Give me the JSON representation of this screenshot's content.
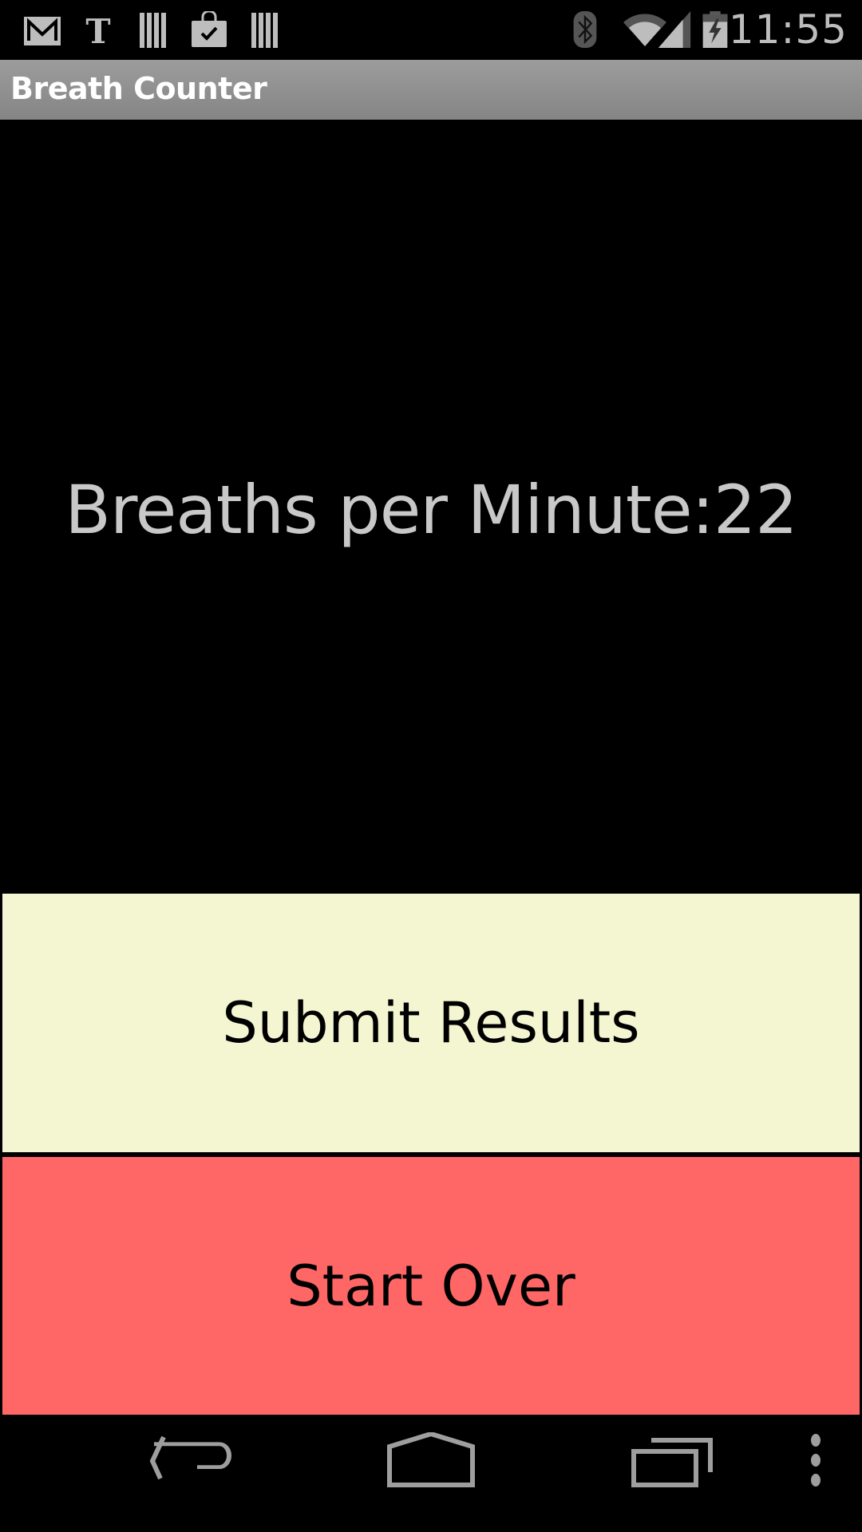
{
  "status_bar": {
    "notification_icons": [
      "gmail-icon",
      "nytimes-icon",
      "barcode-icon",
      "shopping-bag-check-icon",
      "barcode-icon"
    ],
    "system_icons": [
      "bluetooth-icon",
      "wifi-icon",
      "cell-signal-icon",
      "battery-charging-icon"
    ],
    "time": "11:55"
  },
  "action_bar": {
    "title": "Breath Counter"
  },
  "main": {
    "result_text": "Breaths per Minute:22"
  },
  "buttons": {
    "submit_label": "Submit Results",
    "start_over_label": "Start Over"
  },
  "colors": {
    "submit_bg": "#f3f6d0",
    "start_over_bg": "#ff6666",
    "result_text": "#c8c8c8"
  },
  "nav_bar": {
    "buttons": [
      "back-icon",
      "home-icon",
      "recents-icon",
      "overflow-menu-icon"
    ]
  }
}
